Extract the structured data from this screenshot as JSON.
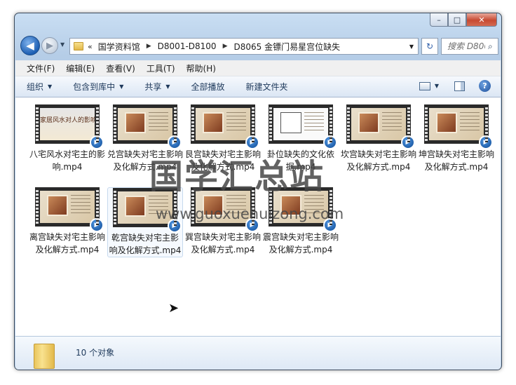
{
  "window": {
    "caption_buttons": {
      "minimize": "–",
      "maximize": "□",
      "close": "✕"
    }
  },
  "nav": {
    "back_glyph": "◀",
    "forward_glyph": "▶",
    "recent_glyph": "▼",
    "address_lead": "«",
    "breadcrumbs": [
      "国学资料馆",
      "D8001-D8100",
      "D8065 金镖门易星宫位缺失"
    ],
    "crumb_sep": "▶",
    "dropdown_glyph": "▼",
    "refresh_glyph": "↻",
    "search_placeholder": "搜索 D806…",
    "search_icon": "⌕"
  },
  "menu": [
    "文件(F)",
    "编辑(E)",
    "查看(V)",
    "工具(T)",
    "帮助(H)"
  ],
  "commands": {
    "organize": "组织",
    "include_library": "包含到库中",
    "share": "共享",
    "play_all": "全部播放",
    "new_folder": "新建文件夹",
    "dropdown_glyph": "▼",
    "help_glyph": "?"
  },
  "files": [
    {
      "label": "八宅风水对宅主的影响.mp4",
      "thumb_text": "家居风水对人的影响",
      "kind": "text"
    },
    {
      "label": "兑宫缺失对宅主影响及化解方式.mp4",
      "kind": "room"
    },
    {
      "label": "艮宫缺失对宅主影响及化解方式.mp4",
      "kind": "room"
    },
    {
      "label": "卦位缺失的文化依据.mp4",
      "kind": "plan"
    },
    {
      "label": "坎宫缺失对宅主影响及化解方式.mp4",
      "kind": "room"
    },
    {
      "label": "坤宫缺失对宅主影响及化解方式.mp4",
      "kind": "room"
    },
    {
      "label": "离宫缺失对宅主影响及化解方式.mp4",
      "kind": "room"
    },
    {
      "label": "乾宫缺失对宅主影响及化解方式.mp4",
      "kind": "room"
    },
    {
      "label": "巽宫缺失对宅主影响及化解方式.mp4",
      "kind": "room"
    },
    {
      "label": "震宫缺失对宅主影响及化解方式.mp4",
      "kind": "room"
    }
  ],
  "media_glyph": "▶",
  "watermark": {
    "text": "国学汇总站",
    "url": "www.guoxuehuizong.com"
  },
  "status": {
    "count": "10 个对象"
  },
  "colors": {
    "accent": "#1e395b",
    "selection": "#c6d9ee",
    "title_gradient": "#c9def3"
  }
}
